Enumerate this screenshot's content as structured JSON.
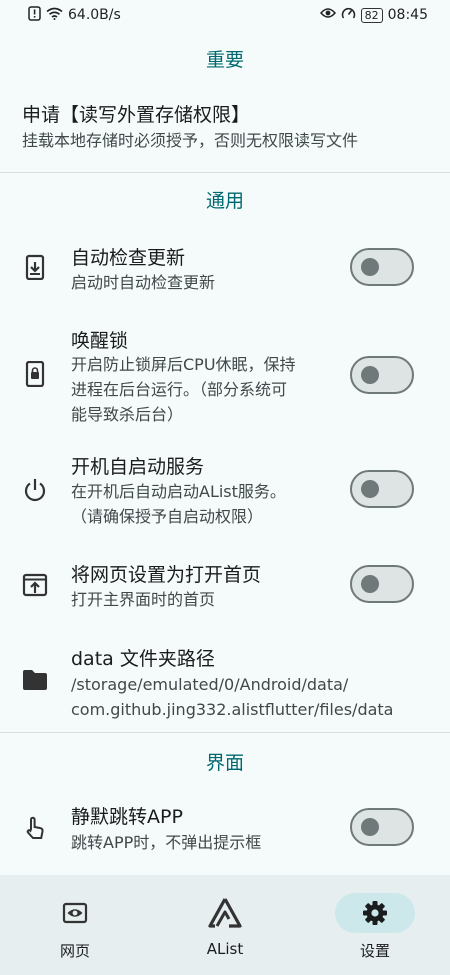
{
  "status_bar": {
    "speed": "64.0B/s",
    "battery": "82",
    "time": "08:45"
  },
  "sections": {
    "important": {
      "title": "重要"
    },
    "general": {
      "title": "通用"
    },
    "interface": {
      "title": "界面"
    }
  },
  "storage_permission": {
    "title": "申请【读写外置存储权限】",
    "subtitle": "挂载本地存储时必须授予，否则无权限读写文件"
  },
  "auto_update": {
    "title": "自动检查更新",
    "subtitle": "启动时自动检查更新",
    "enabled": false
  },
  "wake_lock": {
    "title": "唤醒锁",
    "subtitle_lines": [
      "开启防止锁屏后CPU休眠，保持",
      "进程在后台运行。（部分系统可",
      "能导致杀后台）"
    ],
    "enabled": false
  },
  "boot_start": {
    "title": "开机自启动服务",
    "subtitle_lines": [
      "在开机后自动启动AList服务。",
      "（请确保授予自启动权限）"
    ],
    "enabled": false
  },
  "web_homepage": {
    "title": "将网页设置为打开首页",
    "subtitle": "打开主界面时的首页",
    "enabled": false
  },
  "data_path": {
    "title": "data 文件夹路径",
    "subtitle_lines": [
      "/storage/emulated/0/Android/data/",
      "com.github.jing332.alistflutter/files/data"
    ]
  },
  "silent_jump": {
    "title": "静默跳转APP",
    "subtitle": "跳转APP时，不弹出提示框",
    "enabled": false
  },
  "bottom_nav": {
    "items": [
      {
        "label": "网页",
        "icon": "web-view-icon",
        "active": false
      },
      {
        "label": "AList",
        "icon": "alist-logo-icon",
        "active": false
      },
      {
        "label": "设置",
        "icon": "gear-icon",
        "active": true
      }
    ]
  },
  "colors": {
    "accent": "#00696f",
    "background": "#f5fbfb",
    "nav_background": "#e6eef0",
    "active_pill": "#cce8ea"
  }
}
